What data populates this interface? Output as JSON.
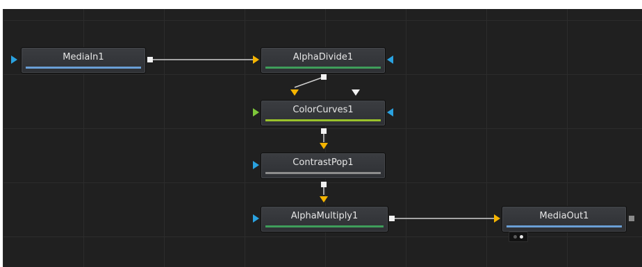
{
  "app": {
    "title": ""
  },
  "flow": {
    "nodes": [
      {
        "id": "mediain1",
        "label": "MediaIn1",
        "bar_color": "#6a9fd6"
      },
      {
        "id": "alphadivide1",
        "label": "AlphaDivide1",
        "bar_color": "#3f9e5b"
      },
      {
        "id": "colorcurves1",
        "label": "ColorCurves1",
        "bar_color": "#9ac22b"
      },
      {
        "id": "contrastpop1",
        "label": "ContrastPop1",
        "bar_color": "#8d8d8d"
      },
      {
        "id": "alphamultiply1",
        "label": "AlphaMultiply1",
        "bar_color": "#3f9e5b"
      },
      {
        "id": "mediaout1",
        "label": "MediaOut1",
        "bar_color": "#6a9fd6"
      }
    ],
    "colors": {
      "wire": "#cfcfcf",
      "input_yellow": "#f5b400",
      "input_blue": "#2aa2e0",
      "input_green": "#7ec83a",
      "mask_white": "#f2f2f2",
      "output_square": "#f2f2f2"
    }
  }
}
